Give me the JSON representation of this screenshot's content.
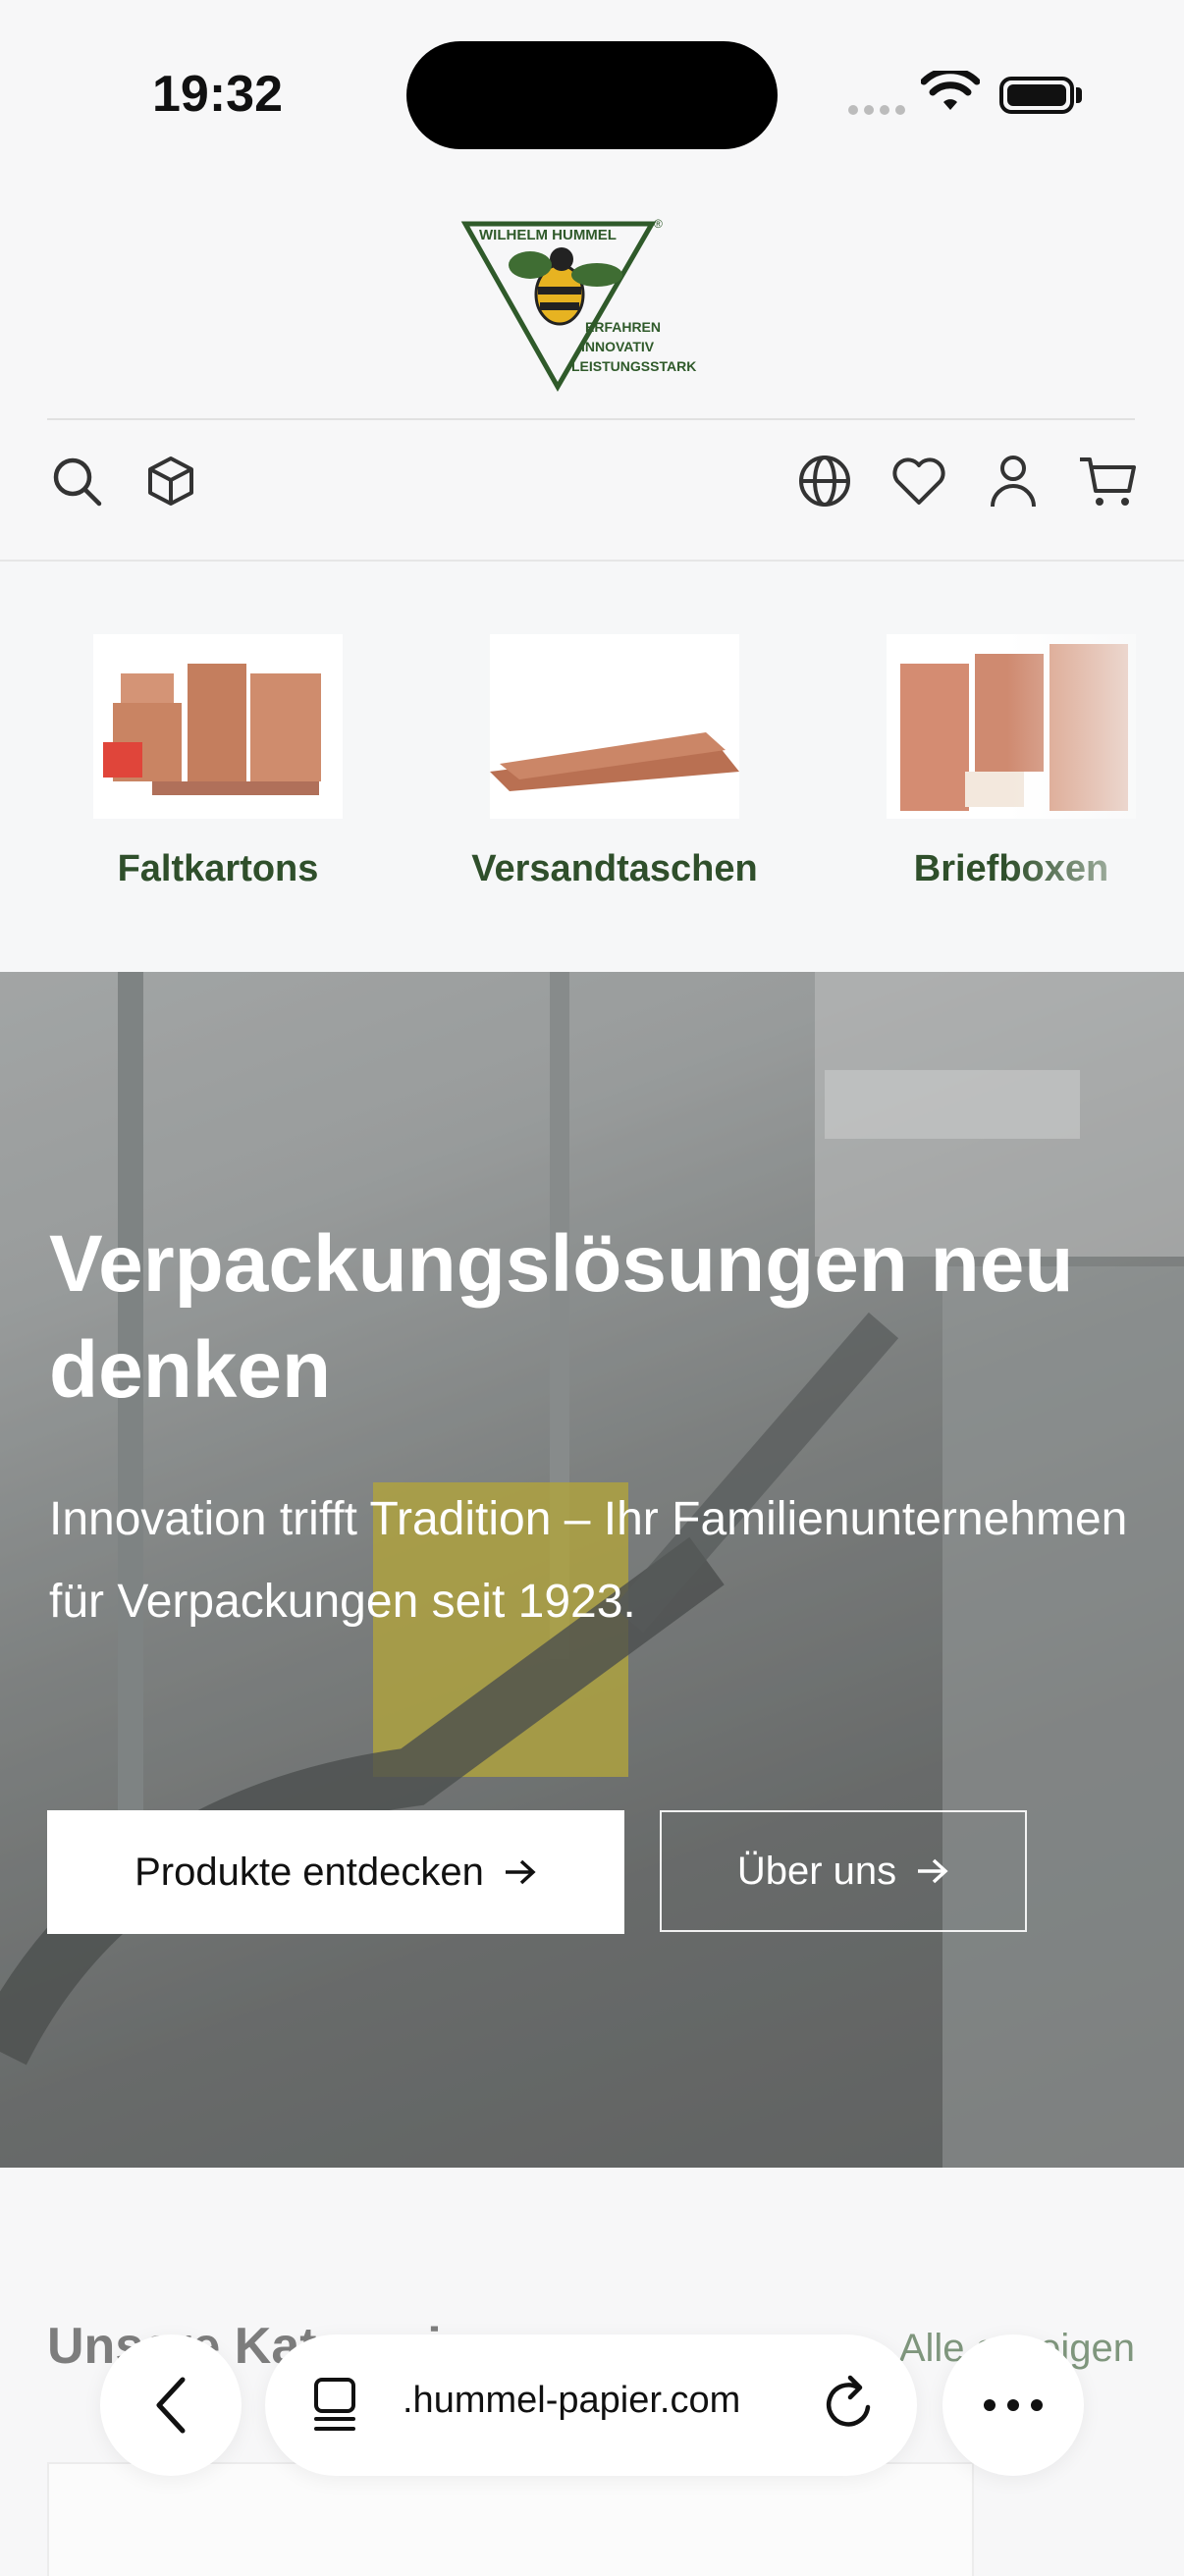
{
  "status_bar": {
    "time": "19:32"
  },
  "brand": {
    "name": "WILHELM HUMMEL",
    "tagline": [
      "ERFAHREN",
      "INNOVATIV",
      "LEISTUNGSSTARK"
    ],
    "logo_green": "#2f5a2a"
  },
  "toolbar": {
    "left_icons": [
      "search-icon",
      "box-icon"
    ],
    "right_icons": [
      "globe-icon",
      "heart-icon",
      "user-icon",
      "cart-icon"
    ]
  },
  "categories": [
    {
      "label": "Faltkartons"
    },
    {
      "label": "Versandtaschen"
    },
    {
      "label": "Briefboxen"
    }
  ],
  "hero": {
    "title": "Verpackungslösungen neu denken",
    "subtitle": "Innovation trifft Tradition – Ihr Familienunternehmen für Verpackungen seit 1923.",
    "primary_button": "Produkte entdecken",
    "secondary_button": "Über uns"
  },
  "section": {
    "title": "Unsere Kategorien",
    "link": "Alle anzeigen"
  },
  "browser": {
    "url": ".hummel-papier.com",
    "icons": [
      "back-icon",
      "tabs-icon",
      "reload-icon",
      "more-icon"
    ]
  },
  "colors": {
    "accent_green": "#2f4f2b",
    "background": "#f7f7f8"
  }
}
